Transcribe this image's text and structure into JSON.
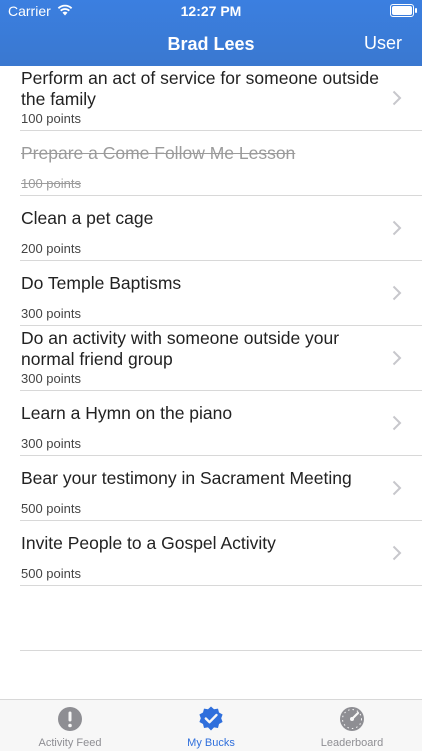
{
  "status_bar": {
    "carrier": "Carrier",
    "time": "12:27 PM"
  },
  "nav": {
    "title": "Brad Lees",
    "right_button": "User"
  },
  "items": [
    {
      "title": "Perform an act of service for someone outside the family",
      "points": "100 points",
      "completed": false
    },
    {
      "title": "Prepare a Come Follow Me Lesson",
      "points": "100 points",
      "completed": true
    },
    {
      "title": "Clean a pet cage",
      "points": "200 points",
      "completed": false
    },
    {
      "title": "Do Temple Baptisms",
      "points": "300 points",
      "completed": false
    },
    {
      "title": "Do an activity with someone outside your normal friend group",
      "points": "300 points",
      "completed": false
    },
    {
      "title": "Learn a Hymn on the piano",
      "points": "300 points",
      "completed": false
    },
    {
      "title": "Bear your testimony in Sacrament Meeting",
      "points": "500 points",
      "completed": false
    },
    {
      "title": "Invite People to a Gospel Activity",
      "points": "500 points",
      "completed": false
    }
  ],
  "tabbar": {
    "tabs": [
      {
        "label": "Activity Feed",
        "icon": "alert-circle-icon",
        "active": false
      },
      {
        "label": "My Bucks",
        "icon": "checkmark-badge-icon",
        "active": true
      },
      {
        "label": "Leaderboard",
        "icon": "gauge-icon",
        "active": false
      }
    ]
  },
  "colors": {
    "accent": "#3a7bd5",
    "completed_text": "#9b9b9b",
    "inactive_tab": "#8e8e93"
  }
}
